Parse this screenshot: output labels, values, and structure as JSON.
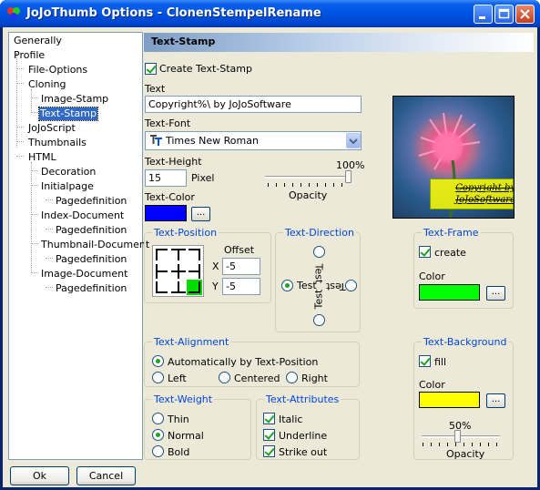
{
  "window": {
    "title": "JoJoThumb Options - ClonenStempelRename"
  },
  "tree": {
    "items": [
      {
        "label": "Generally"
      },
      {
        "label": "Profile"
      },
      {
        "label": "File-Options"
      },
      {
        "label": "Cloning"
      },
      {
        "label": "Image-Stamp"
      },
      {
        "label": "Text-Stamp"
      },
      {
        "label": "JoJoScript"
      },
      {
        "label": "Thumbnails"
      },
      {
        "label": "HTML"
      },
      {
        "label": "Decoration"
      },
      {
        "label": "Initialpage"
      },
      {
        "label": "Pagedefinition"
      },
      {
        "label": "Index-Document"
      },
      {
        "label": "Pagedefinition"
      },
      {
        "label": "Thumbnail-Document"
      },
      {
        "label": "Pagedefinition"
      },
      {
        "label": "Image-Document"
      },
      {
        "label": "Pagedefinition"
      }
    ],
    "selected": "Text-Stamp"
  },
  "footer": {
    "ok": "Ok",
    "cancel": "Cancel"
  },
  "section": {
    "title": "Text-Stamp"
  },
  "stamp": {
    "create_label": "Create Text-Stamp",
    "create_checked": true,
    "text_label": "Text",
    "text_value": "Copyright%\\ by JoJoSoftware",
    "font_label": "Text-Font",
    "font_value": "Times New Roman",
    "font_icon": "truetype-font-icon",
    "height_label": "Text-Height",
    "height_value": "15",
    "height_unit": "Pixel",
    "opacity_pct": "100%",
    "opacity_label": "Opacity",
    "color_label": "Text-Color",
    "color_value": "#0000ff",
    "ellipsis": "..."
  },
  "position": {
    "title": "Text-Position",
    "offset_label": "Offset",
    "x_label": "X",
    "x_value": "-5",
    "y_label": "Y",
    "y_value": "-5",
    "selected": "bottom-right"
  },
  "direction": {
    "title": "Text-Direction",
    "sample": "Test",
    "selected": "left"
  },
  "frame": {
    "title": "Text-Frame",
    "create_label": "create",
    "create_checked": true,
    "color_label": "Color",
    "color_value": "#00ff00",
    "ellipsis": "..."
  },
  "alignment": {
    "title": "Text-Alignment",
    "auto_label": "Automatically by Text-Position",
    "left_label": "Left",
    "centered_label": "Centered",
    "right_label": "Right",
    "selected": "auto"
  },
  "weight": {
    "title": "Text-Weight",
    "thin_label": "Thin",
    "normal_label": "Normal",
    "bold_label": "Bold",
    "selected": "Normal"
  },
  "attributes": {
    "title": "Text-Attributes",
    "italic_label": "Italic",
    "underline_label": "Underline",
    "strikeout_label": "Strike out",
    "italic": true,
    "underline": true,
    "strikeout": true
  },
  "background": {
    "title": "Text-Background",
    "fill_label": "fill",
    "fill_checked": true,
    "color_label": "Color",
    "color_value": "#ffff00",
    "ellipsis": "...",
    "opacity_pct": "50%",
    "opacity_label": "Opacity"
  },
  "preview": {
    "overlay_text": "Copyright by JoJoSoftware"
  }
}
